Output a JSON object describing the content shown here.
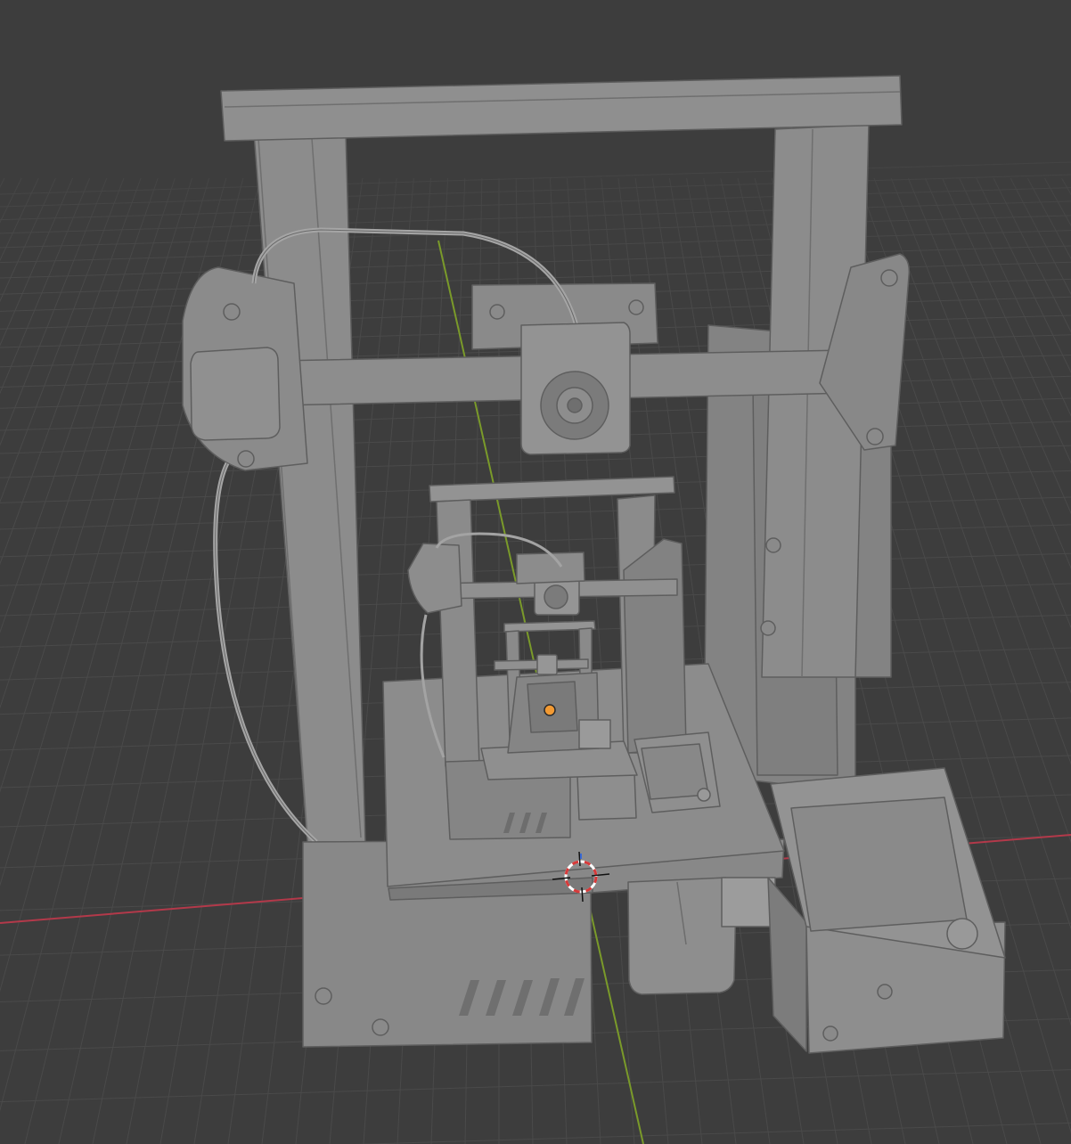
{
  "viewport": {
    "background_color": "#3d3d3d",
    "grid_line_color": "#4a4a4a",
    "x_axis_color": "#b3394a",
    "y_axis_color": "#7a9a2a",
    "model_fill_color": "#8a8a8a",
    "model_shade_color": "#7a7a7a",
    "model_edge_color": "#5e5e5e",
    "origin_color": "#f29a33",
    "cursor_ring_colors": [
      "#d63a3a",
      "#ffffff"
    ]
  },
  "scene": {
    "model": "printer-model",
    "icons": {
      "cursor": "3d-cursor-icon",
      "origin": "object-origin-icon"
    }
  }
}
